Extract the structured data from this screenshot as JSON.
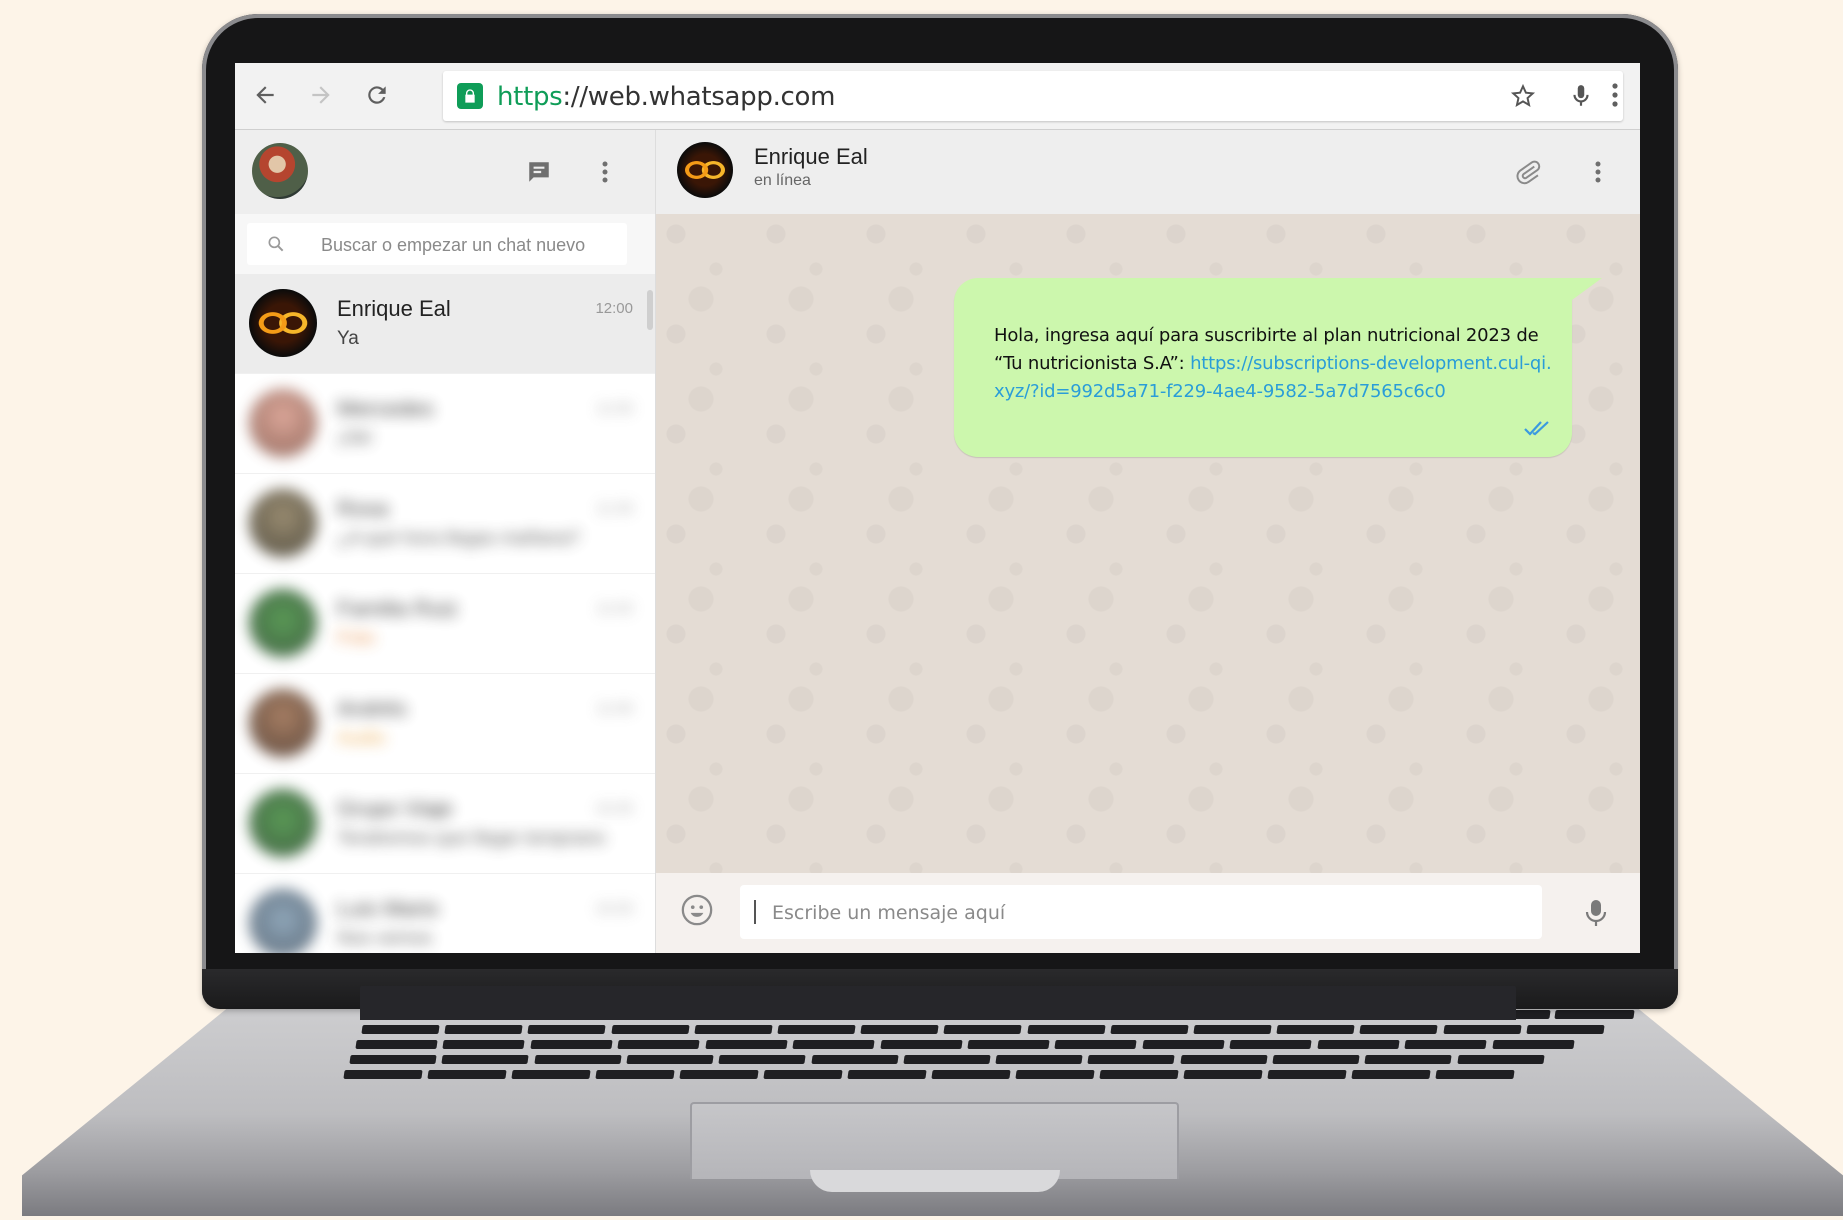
{
  "browser": {
    "url_scheme": "https",
    "url_rest": "://web.whatsapp.com",
    "back_icon": "arrow-left-icon",
    "forward_icon": "arrow-right-icon",
    "reload_icon": "reload-icon",
    "star_icon": "star-icon",
    "mic_icon": "mic-icon",
    "menu_icon": "kebab-menu-icon"
  },
  "sidebar": {
    "search_placeholder": "Buscar o empezar un chat nuevo",
    "chats": [
      {
        "name": "Enrique Eal",
        "preview": "Ya",
        "time": "12:00",
        "active": true
      },
      {
        "name": "Mercedes",
        "preview": "¡Ok!",
        "time": "11:50",
        "blurred": true
      },
      {
        "name": "Rosa",
        "preview": "¿A qué hora llegas mañana?",
        "time": "11:30",
        "blurred": true
      },
      {
        "name": "Familia Ruiz",
        "preview": "Foto",
        "time": "11:02",
        "blurred": true
      },
      {
        "name": "Andrés",
        "preview": "Audio",
        "time": "11:00",
        "blurred": true
      },
      {
        "name": "Grupo Viaje",
        "preview": "Tendremos que llegar temprano",
        "time": "10:45",
        "blurred": true
      },
      {
        "name": "Luis Mario",
        "preview": "Nos vemos",
        "time": "10:20",
        "blurred": true
      }
    ]
  },
  "conversation": {
    "contact_name": "Enrique Eal",
    "contact_status": "en línea",
    "message": {
      "text": "Hola, ingresa aquí para suscribirte al plan nutricional 2023 de “Tu nutricionista S.A”: ",
      "link": "https://subscriptions-development.cul-qi.xyz/?id=992d5a71-f229-4ae4-9582-5a7d7565c6c0",
      "status_icon": "double-check-icon",
      "status_color": "#3a9ae0"
    },
    "compose_placeholder": "Escribe un mensaje aquí"
  },
  "colors": {
    "page_background": "#fdf4e8",
    "outgoing_bubble": "#ccf7ad",
    "link": "#2a9dd8",
    "secure_green": "#0f9d58"
  }
}
